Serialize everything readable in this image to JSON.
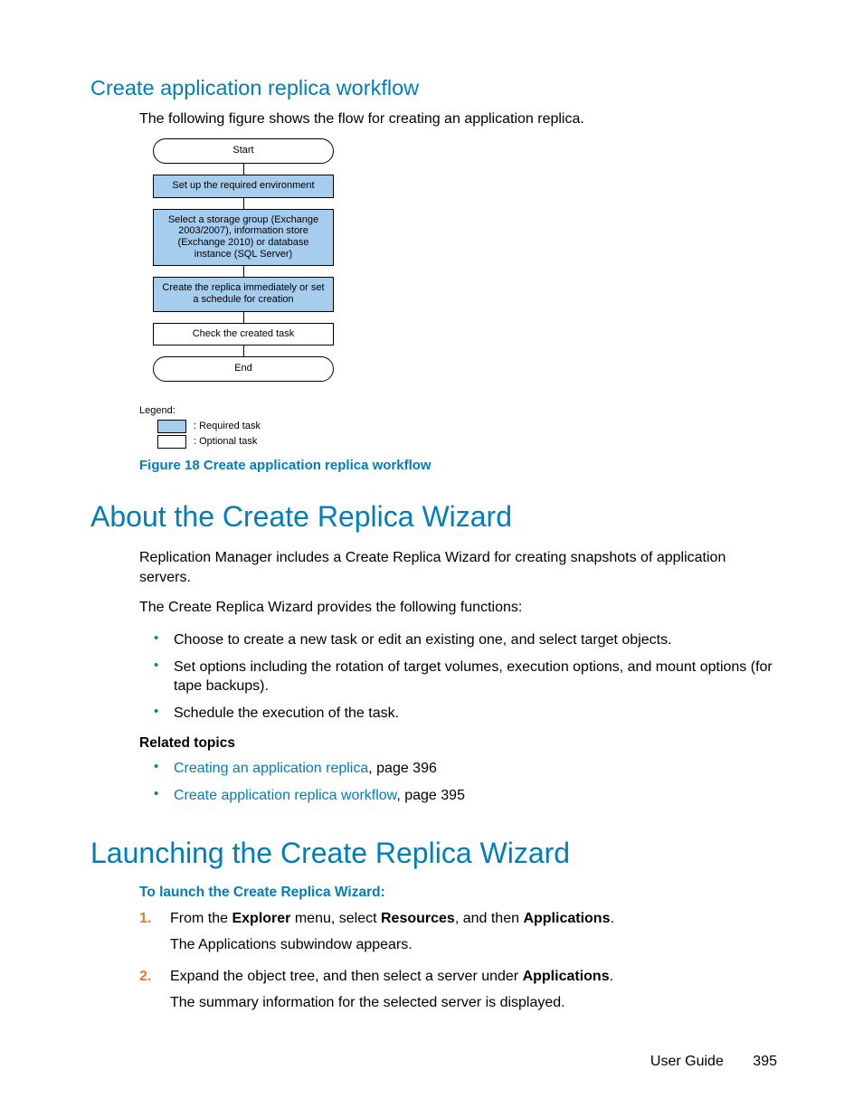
{
  "section1": {
    "title": "Create application replica workflow",
    "intro": "The following figure shows the flow for creating an application replica.",
    "figcaption": "Figure 18 Create application replica workflow"
  },
  "flow": {
    "start": "Start",
    "n1": "Set up the required environment",
    "n2": "Select a storage group (Exchange 2003/2007), information store (Exchange 2010) or database instance (SQL Server)",
    "n3": "Create the replica immediately or set a schedule for creation",
    "n4": "Check the created task",
    "end": "End"
  },
  "legend": {
    "title": "Legend:",
    "req": ": Required task",
    "opt": ": Optional task"
  },
  "section2": {
    "title": "About the Create Replica Wizard",
    "p1": "Replication Manager includes a Create Replica Wizard for creating snapshots of application servers.",
    "p2": "The Create Replica Wizard provides the following functions:",
    "bullets": [
      "Choose to create a new task or edit an existing one, and select target objects.",
      "Set options including the rotation of target volumes, execution options, and mount options (for tape backups).",
      "Schedule the execution of the task."
    ],
    "related_h": "Related topics",
    "related": [
      {
        "link": "Creating an application replica",
        "suffix": ", page 396"
      },
      {
        "link": "Create application replica workflow",
        "suffix": ", page 395"
      }
    ]
  },
  "section3": {
    "title": "Launching the Create Replica Wizard",
    "proc_h": "To launch the Create Replica Wizard:",
    "steps": [
      {
        "pre": "From the ",
        "b1": "Explorer",
        "mid1": " menu, select ",
        "b2": "Resources",
        "mid2": ", and then ",
        "b3": "Applications",
        "post": ".",
        "sub": "The Applications subwindow appears."
      },
      {
        "pre": "Expand the object tree, and then select a server under ",
        "b1": "Applications",
        "post": ".",
        "sub": "The summary information for the selected server is displayed."
      }
    ]
  },
  "footer": {
    "label": "User Guide",
    "page": "395"
  }
}
